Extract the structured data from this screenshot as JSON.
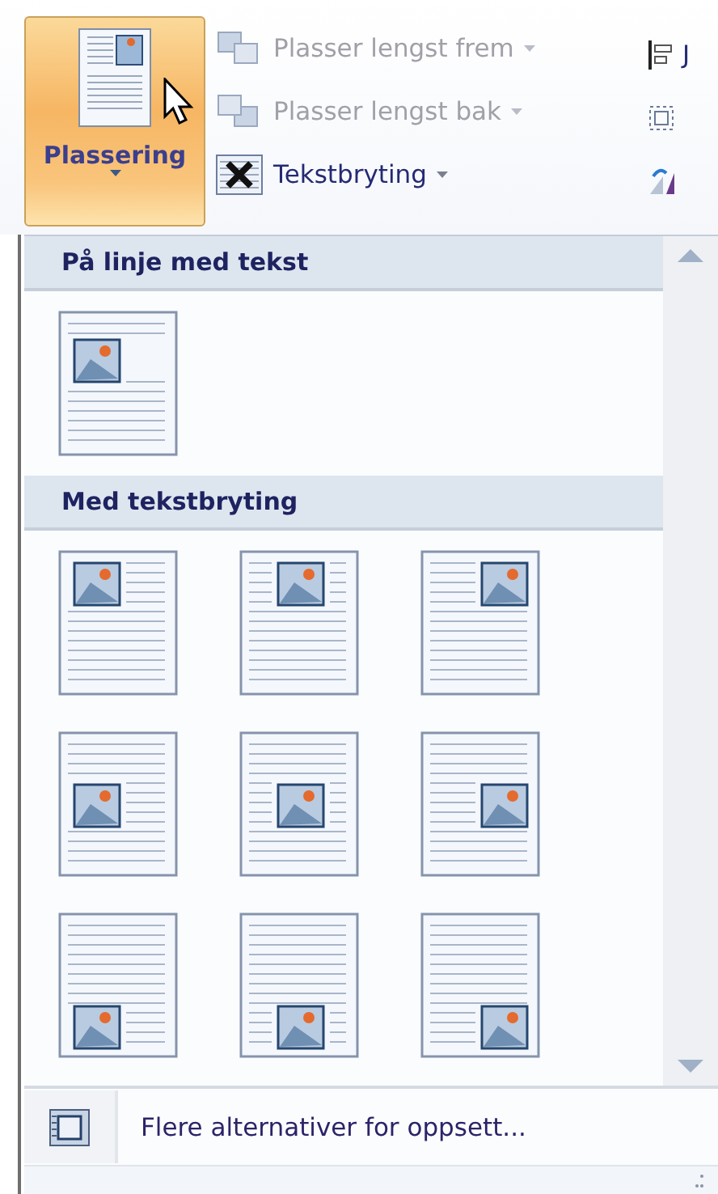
{
  "ribbon": {
    "main_button": {
      "label": "Plassering",
      "active": true
    },
    "items": [
      {
        "label": "Plasser lengst frem",
        "disabled": true,
        "dropdown": true
      },
      {
        "label": "Plasser lengst bak",
        "disabled": true,
        "dropdown": true
      },
      {
        "label": "Tekstbryting",
        "disabled": false,
        "dropdown": true
      }
    ],
    "cut_item": {
      "label": "J"
    }
  },
  "gallery": {
    "sections": [
      {
        "title": "På linje med tekst",
        "options": [
          {
            "kind": "inline"
          }
        ]
      },
      {
        "title": "Med tekstbryting",
        "options": [
          {
            "kind": "top_left"
          },
          {
            "kind": "top_center"
          },
          {
            "kind": "top_right"
          },
          {
            "kind": "middle_left"
          },
          {
            "kind": "middle_center"
          },
          {
            "kind": "middle_right"
          },
          {
            "kind": "bottom_left"
          },
          {
            "kind": "bottom_center"
          },
          {
            "kind": "bottom_right"
          }
        ]
      }
    ],
    "footer": {
      "label": "Flere alternativer for oppsett..."
    }
  }
}
